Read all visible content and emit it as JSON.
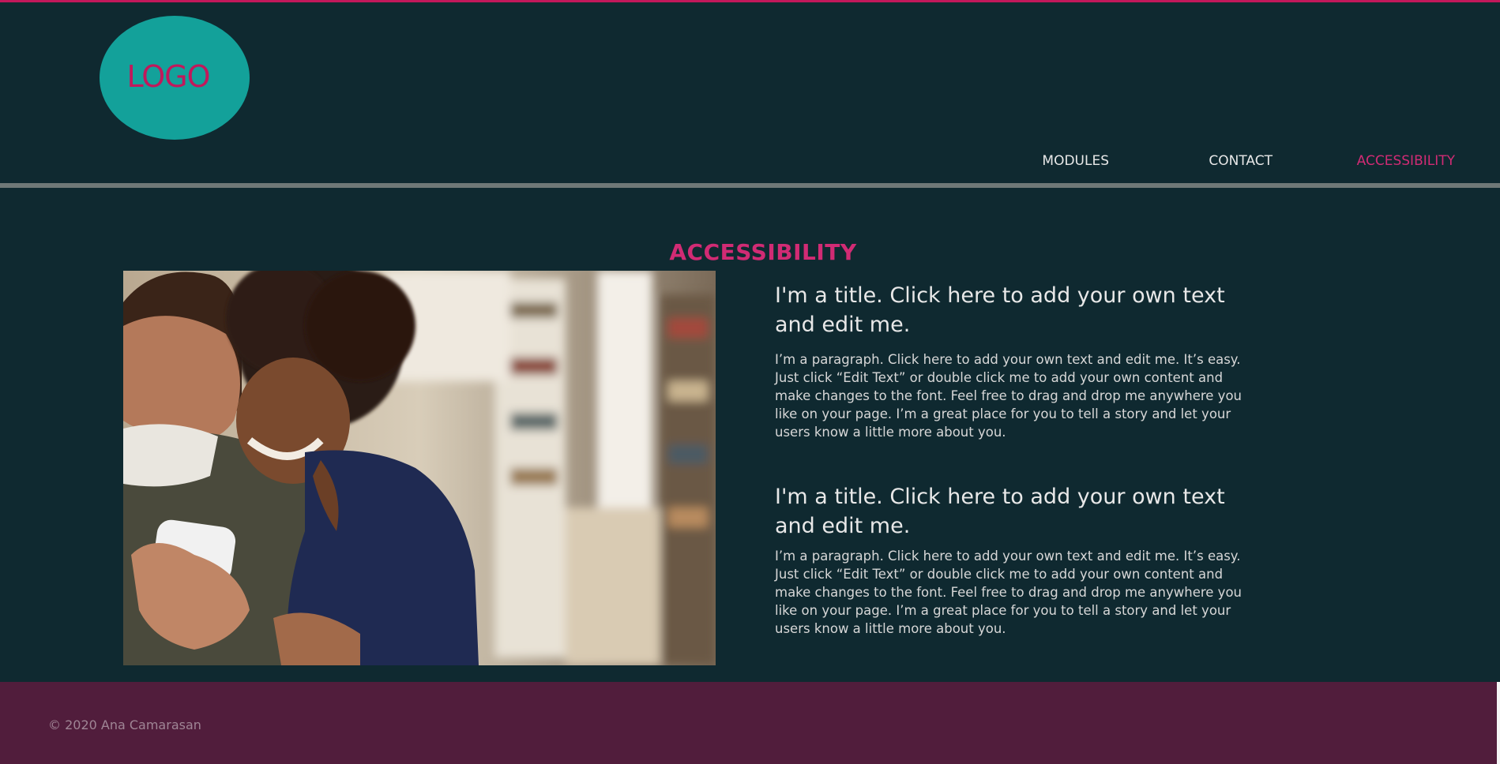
{
  "header": {
    "logo_text": "LOGO",
    "nav": {
      "modules": "MODULES",
      "contact": "CONTACT",
      "accessibility": "ACCESSIBILITY"
    }
  },
  "main": {
    "section_title": "ACCESSIBILITY",
    "photo_icon": "photo-couple-phone",
    "blocks": [
      {
        "title": "I'm a title. Click here to add your own text and edit me.",
        "paragraph": "I’m a paragraph. Click here to add your own text and edit me. It’s easy. Just click “Edit Text” or double click me to add your own content and make changes to the font. Feel free to drag and drop me anywhere you like on your page. I’m a great place for you to tell a story and let your users know a little more about you."
      },
      {
        "title": "I'm a title. Click here to add your own text and edit me.",
        "paragraph": "I’m a paragraph. Click here to add your own text and edit me. It’s easy. Just click “Edit Text” or double click me to add your own content and make changes to the font. Feel free to drag and drop me anywhere you like on your page. I’m a great place for you to tell a story and let your users know a little more about you."
      }
    ]
  },
  "footer": {
    "copyright": "© 2020 Ana Camarasan"
  },
  "colors": {
    "background": "#0f2930",
    "accent": "#d12b74",
    "logo_fill": "#13a19a",
    "divider": "#6f7877",
    "footer": "#511d3c"
  }
}
